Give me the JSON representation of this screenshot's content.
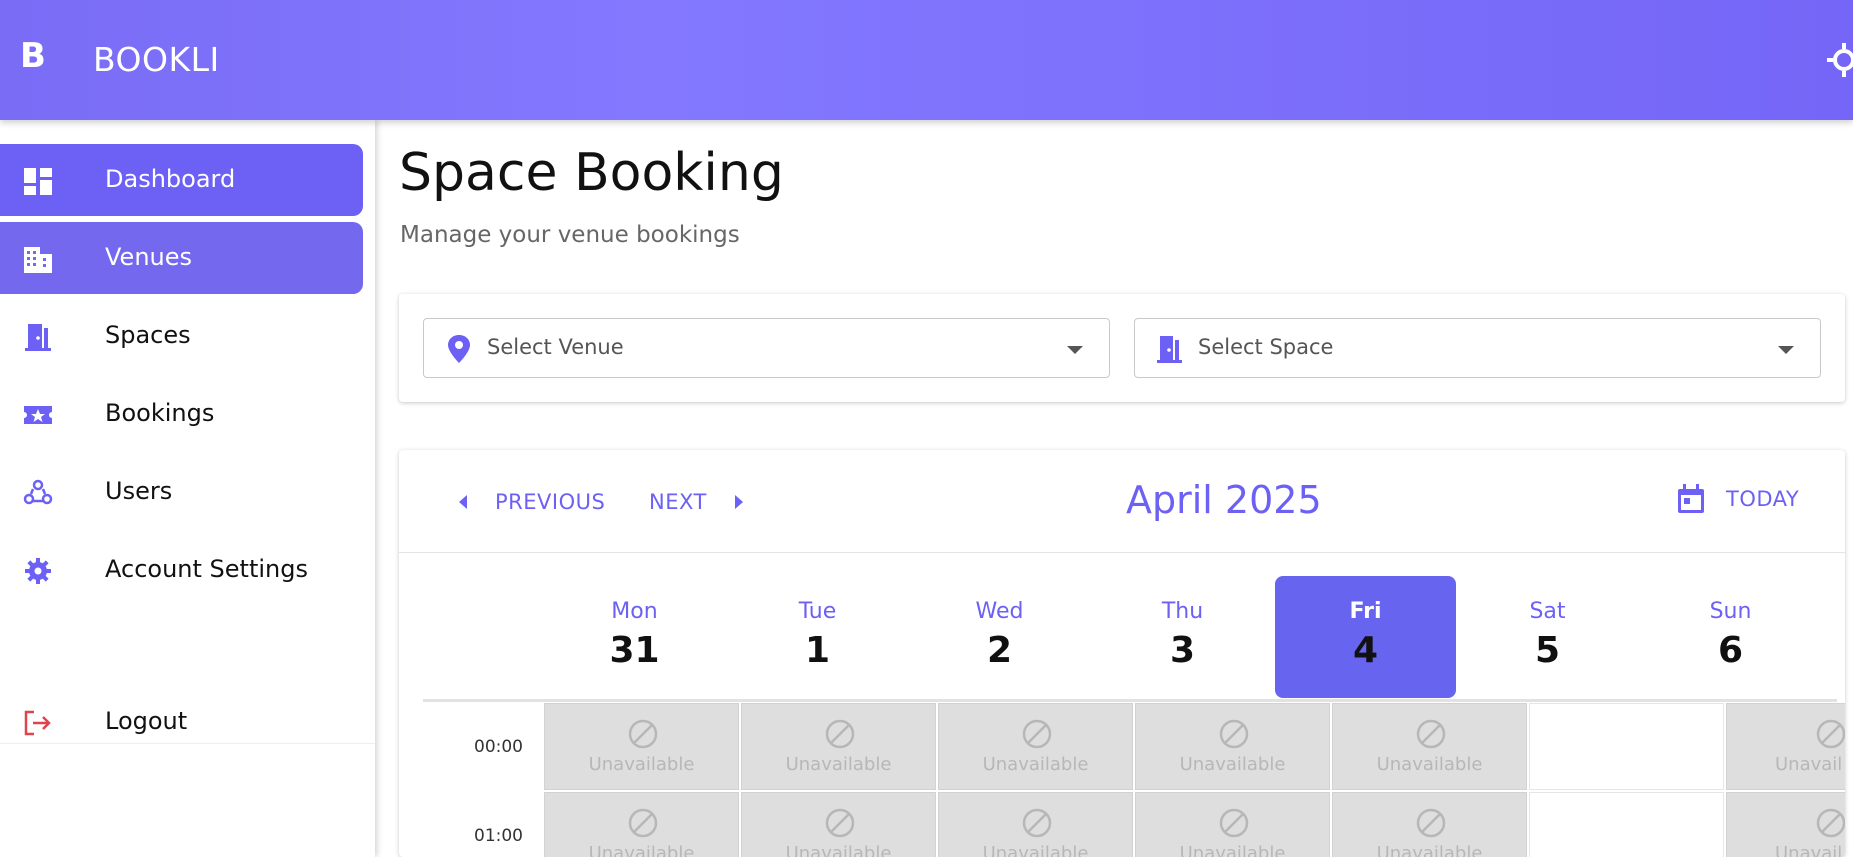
{
  "app": {
    "logo": "B",
    "title": "BOOKLI"
  },
  "sidebar": {
    "items": [
      {
        "label": "Dashboard",
        "icon": "dashboard-icon",
        "active": true
      },
      {
        "label": "Venues",
        "icon": "building-icon",
        "active": true
      },
      {
        "label": "Spaces",
        "icon": "door-icon",
        "active": false
      },
      {
        "label": "Bookings",
        "icon": "ticket-icon",
        "active": false
      },
      {
        "label": "Users",
        "icon": "users-icon",
        "active": false
      },
      {
        "label": "Account Settings",
        "icon": "gear-icon",
        "active": false
      }
    ],
    "logout_label": "Logout"
  },
  "page": {
    "title": "Space Booking",
    "subtitle": "Manage your venue bookings"
  },
  "filters": {
    "venue_placeholder": "Select Venue",
    "space_placeholder": "Select Space"
  },
  "calendar": {
    "previous_label": "PREVIOUS",
    "next_label": "NEXT",
    "month": "April 2025",
    "today_label": "TODAY",
    "days": [
      {
        "name": "Mon",
        "num": "31"
      },
      {
        "name": "Tue",
        "num": "1"
      },
      {
        "name": "Wed",
        "num": "2"
      },
      {
        "name": "Thu",
        "num": "3"
      },
      {
        "name": "Fri",
        "num": "4",
        "selected": true
      },
      {
        "name": "Sat",
        "num": "5"
      },
      {
        "name": "Sun",
        "num": "6"
      }
    ],
    "times": [
      "00:00",
      "01:00"
    ],
    "unavailable_label": "Unavailable",
    "unavailable_partial_label": "Unavail"
  },
  "colors": {
    "accent": "#6c60f5",
    "header": "#7a6cf5",
    "logout": "#e0434c"
  }
}
